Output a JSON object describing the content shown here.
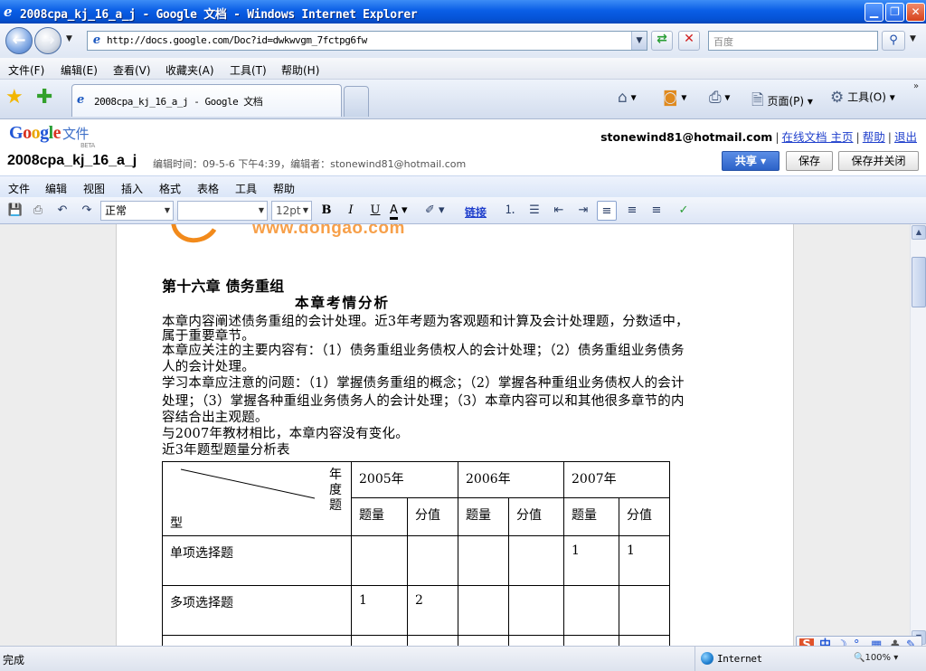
{
  "window": {
    "title": "2008cpa_kj_16_a_j - Google 文档 - Windows Internet Explorer",
    "minimize": "▁",
    "restore": "❐",
    "close": "✕"
  },
  "address": {
    "url": "http://docs.google.com/Doc?id=dwkwvgm_7fctpg6fw",
    "search_placeholder": "百度"
  },
  "ie_menu": [
    "文件(F)",
    "编辑(E)",
    "查看(V)",
    "收藏夹(A)",
    "工具(T)",
    "帮助(H)"
  ],
  "tab": {
    "title": "2008cpa_kj_16_a_j - Google 文档"
  },
  "command_bar": {
    "page": "页面(P)",
    "tools": "工具(O)"
  },
  "gdocs": {
    "logo_google": [
      "G",
      "o",
      "o",
      "g",
      "l",
      "e"
    ],
    "logo_product": "文件",
    "logo_beta": "BETA",
    "user_email": "stonewind81@hotmail.com",
    "links": [
      "在线文档 主页",
      "帮助",
      "退出"
    ],
    "doc_title": "2008cpa_kj_16_a_j",
    "doc_meta": "编辑时间：09-5-6 下午4:39，编辑者：stonewind81@hotmail.com",
    "share": "共享 ▾",
    "save": "保存",
    "save_close": "保存并关闭"
  },
  "doc_menu": [
    "文件",
    "编辑",
    "视图",
    "插入",
    "格式",
    "表格",
    "工具",
    "帮助"
  ],
  "toolbar": {
    "style": "正常",
    "font": "",
    "size": "12pt",
    "link": "链接"
  },
  "document": {
    "logo_text": "www.dongao.com",
    "chapter": "第十六章  债务重组",
    "subtitle": "本章考情分析",
    "lines": [
      "本章内容阐述债务重组的会计处理。近3年考题为客观题和计算及会计处理题，分数适中，",
      "属于重要章节。",
      "本章应关注的主要内容有：（1）债务重组业务债权人的会计处理；（2）债务重组业务债务",
      "人的会计处理。",
      "学习本章应注意的问题：（1）掌握债务重组的概念；（2）掌握各种重组业务债权人的会计",
      "处理；（3）掌握各种重组业务债务人的会计处理；（3）本章内容可以和其他很多章节的内",
      "容结合出主观题。",
      "与2007年教材相比，本章内容没有变化。"
    ],
    "table_caption": "近3年题型题量分析表",
    "table": {
      "header_year": [
        "年",
        "度",
        "题"
      ],
      "header_type": "型",
      "years": [
        "2005年",
        "2006年",
        "2007年"
      ],
      "sub_headers": [
        "题量",
        "分值",
        "题量",
        "分值",
        "题量",
        "分值"
      ],
      "rows": [
        {
          "type": "单项选择题",
          "cells": [
            "",
            "",
            "",
            "",
            "1",
            "1"
          ]
        },
        {
          "type": "多项选择题",
          "cells": [
            "1",
            "2",
            "",
            "",
            "",
            ""
          ]
        }
      ]
    }
  },
  "ime": [
    "S",
    "中",
    "☽",
    "°,",
    "▦",
    "♣",
    "✎"
  ],
  "status": {
    "text": "完成",
    "zone": "Internet",
    "zoom": "🔍100% ▾"
  }
}
